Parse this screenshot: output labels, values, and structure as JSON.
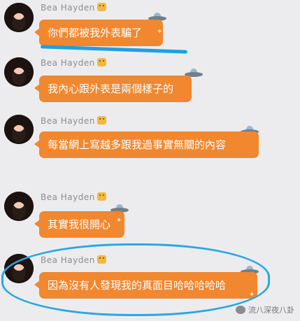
{
  "chat": {
    "sender_name": "Bea Hayden",
    "messages": [
      {
        "text": "你們都被我外表騙了"
      },
      {
        "text": "我內心跟外表是兩個樣子的"
      },
      {
        "text": "每當網上寫越多跟我過事實無關的內容"
      },
      {
        "text": "其實我很開心"
      },
      {
        "text": "因為沒有人發現我的真面目哈哈哈哈哈"
      }
    ]
  },
  "watermark": {
    "text": "流八深夜八卦"
  },
  "colors": {
    "bubble": "#f1872f",
    "annotation_blue": "#2aa7e3",
    "background": "#ececee"
  }
}
